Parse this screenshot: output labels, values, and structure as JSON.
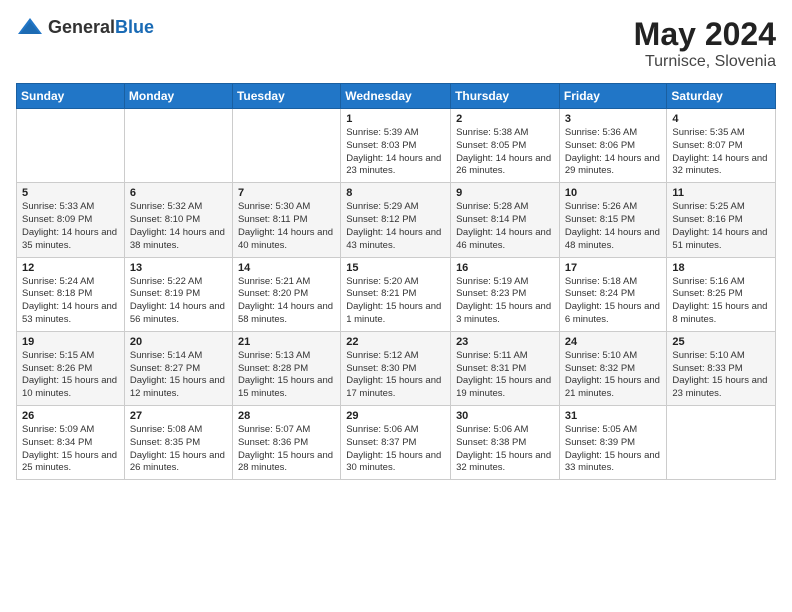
{
  "header": {
    "logo_general": "General",
    "logo_blue": "Blue",
    "month": "May 2024",
    "location": "Turnisce, Slovenia"
  },
  "weekdays": [
    "Sunday",
    "Monday",
    "Tuesday",
    "Wednesday",
    "Thursday",
    "Friday",
    "Saturday"
  ],
  "weeks": [
    [
      {
        "day": "",
        "content": ""
      },
      {
        "day": "",
        "content": ""
      },
      {
        "day": "",
        "content": ""
      },
      {
        "day": "1",
        "content": "Sunrise: 5:39 AM\nSunset: 8:03 PM\nDaylight: 14 hours\nand 23 minutes."
      },
      {
        "day": "2",
        "content": "Sunrise: 5:38 AM\nSunset: 8:05 PM\nDaylight: 14 hours\nand 26 minutes."
      },
      {
        "day": "3",
        "content": "Sunrise: 5:36 AM\nSunset: 8:06 PM\nDaylight: 14 hours\nand 29 minutes."
      },
      {
        "day": "4",
        "content": "Sunrise: 5:35 AM\nSunset: 8:07 PM\nDaylight: 14 hours\nand 32 minutes."
      }
    ],
    [
      {
        "day": "5",
        "content": "Sunrise: 5:33 AM\nSunset: 8:09 PM\nDaylight: 14 hours\nand 35 minutes."
      },
      {
        "day": "6",
        "content": "Sunrise: 5:32 AM\nSunset: 8:10 PM\nDaylight: 14 hours\nand 38 minutes."
      },
      {
        "day": "7",
        "content": "Sunrise: 5:30 AM\nSunset: 8:11 PM\nDaylight: 14 hours\nand 40 minutes."
      },
      {
        "day": "8",
        "content": "Sunrise: 5:29 AM\nSunset: 8:12 PM\nDaylight: 14 hours\nand 43 minutes."
      },
      {
        "day": "9",
        "content": "Sunrise: 5:28 AM\nSunset: 8:14 PM\nDaylight: 14 hours\nand 46 minutes."
      },
      {
        "day": "10",
        "content": "Sunrise: 5:26 AM\nSunset: 8:15 PM\nDaylight: 14 hours\nand 48 minutes."
      },
      {
        "day": "11",
        "content": "Sunrise: 5:25 AM\nSunset: 8:16 PM\nDaylight: 14 hours\nand 51 minutes."
      }
    ],
    [
      {
        "day": "12",
        "content": "Sunrise: 5:24 AM\nSunset: 8:18 PM\nDaylight: 14 hours\nand 53 minutes."
      },
      {
        "day": "13",
        "content": "Sunrise: 5:22 AM\nSunset: 8:19 PM\nDaylight: 14 hours\nand 56 minutes."
      },
      {
        "day": "14",
        "content": "Sunrise: 5:21 AM\nSunset: 8:20 PM\nDaylight: 14 hours\nand 58 minutes."
      },
      {
        "day": "15",
        "content": "Sunrise: 5:20 AM\nSunset: 8:21 PM\nDaylight: 15 hours\nand 1 minute."
      },
      {
        "day": "16",
        "content": "Sunrise: 5:19 AM\nSunset: 8:23 PM\nDaylight: 15 hours\nand 3 minutes."
      },
      {
        "day": "17",
        "content": "Sunrise: 5:18 AM\nSunset: 8:24 PM\nDaylight: 15 hours\nand 6 minutes."
      },
      {
        "day": "18",
        "content": "Sunrise: 5:16 AM\nSunset: 8:25 PM\nDaylight: 15 hours\nand 8 minutes."
      }
    ],
    [
      {
        "day": "19",
        "content": "Sunrise: 5:15 AM\nSunset: 8:26 PM\nDaylight: 15 hours\nand 10 minutes."
      },
      {
        "day": "20",
        "content": "Sunrise: 5:14 AM\nSunset: 8:27 PM\nDaylight: 15 hours\nand 12 minutes."
      },
      {
        "day": "21",
        "content": "Sunrise: 5:13 AM\nSunset: 8:28 PM\nDaylight: 15 hours\nand 15 minutes."
      },
      {
        "day": "22",
        "content": "Sunrise: 5:12 AM\nSunset: 8:30 PM\nDaylight: 15 hours\nand 17 minutes."
      },
      {
        "day": "23",
        "content": "Sunrise: 5:11 AM\nSunset: 8:31 PM\nDaylight: 15 hours\nand 19 minutes."
      },
      {
        "day": "24",
        "content": "Sunrise: 5:10 AM\nSunset: 8:32 PM\nDaylight: 15 hours\nand 21 minutes."
      },
      {
        "day": "25",
        "content": "Sunrise: 5:10 AM\nSunset: 8:33 PM\nDaylight: 15 hours\nand 23 minutes."
      }
    ],
    [
      {
        "day": "26",
        "content": "Sunrise: 5:09 AM\nSunset: 8:34 PM\nDaylight: 15 hours\nand 25 minutes."
      },
      {
        "day": "27",
        "content": "Sunrise: 5:08 AM\nSunset: 8:35 PM\nDaylight: 15 hours\nand 26 minutes."
      },
      {
        "day": "28",
        "content": "Sunrise: 5:07 AM\nSunset: 8:36 PM\nDaylight: 15 hours\nand 28 minutes."
      },
      {
        "day": "29",
        "content": "Sunrise: 5:06 AM\nSunset: 8:37 PM\nDaylight: 15 hours\nand 30 minutes."
      },
      {
        "day": "30",
        "content": "Sunrise: 5:06 AM\nSunset: 8:38 PM\nDaylight: 15 hours\nand 32 minutes."
      },
      {
        "day": "31",
        "content": "Sunrise: 5:05 AM\nSunset: 8:39 PM\nDaylight: 15 hours\nand 33 minutes."
      },
      {
        "day": "",
        "content": ""
      }
    ]
  ]
}
